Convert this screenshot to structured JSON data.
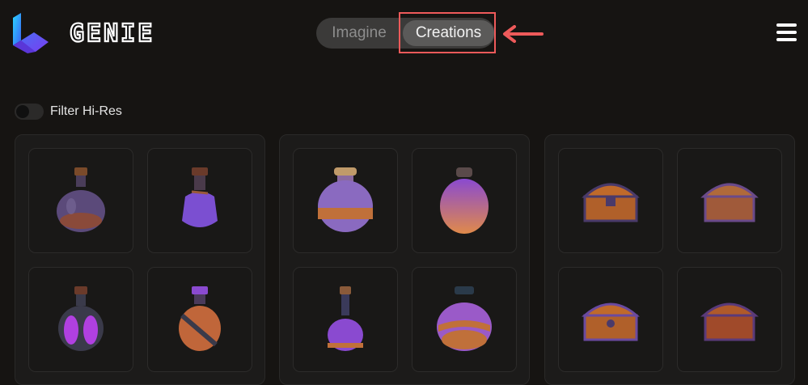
{
  "app": {
    "name": "GENIE"
  },
  "tabs": {
    "imagine": "Imagine",
    "creations": "Creations",
    "active": "Creations"
  },
  "filter": {
    "label": "Filter Hi-Res",
    "enabled": false
  },
  "colors": {
    "background": "#161412",
    "highlight": "#ee5a5a",
    "purple": "#7b4fd1",
    "orange": "#d9824a"
  },
  "groups": [
    {
      "items": [
        "potion",
        "potion",
        "potion",
        "potion"
      ]
    },
    {
      "items": [
        "potion",
        "potion",
        "potion",
        "potion"
      ]
    },
    {
      "items": [
        "treasure-chest",
        "treasure-chest",
        "treasure-chest",
        "treasure-chest"
      ]
    }
  ],
  "icons": {
    "logo": "genie-logo-icon",
    "menu": "hamburger-menu-icon",
    "arrow": "arrow-left-icon"
  }
}
